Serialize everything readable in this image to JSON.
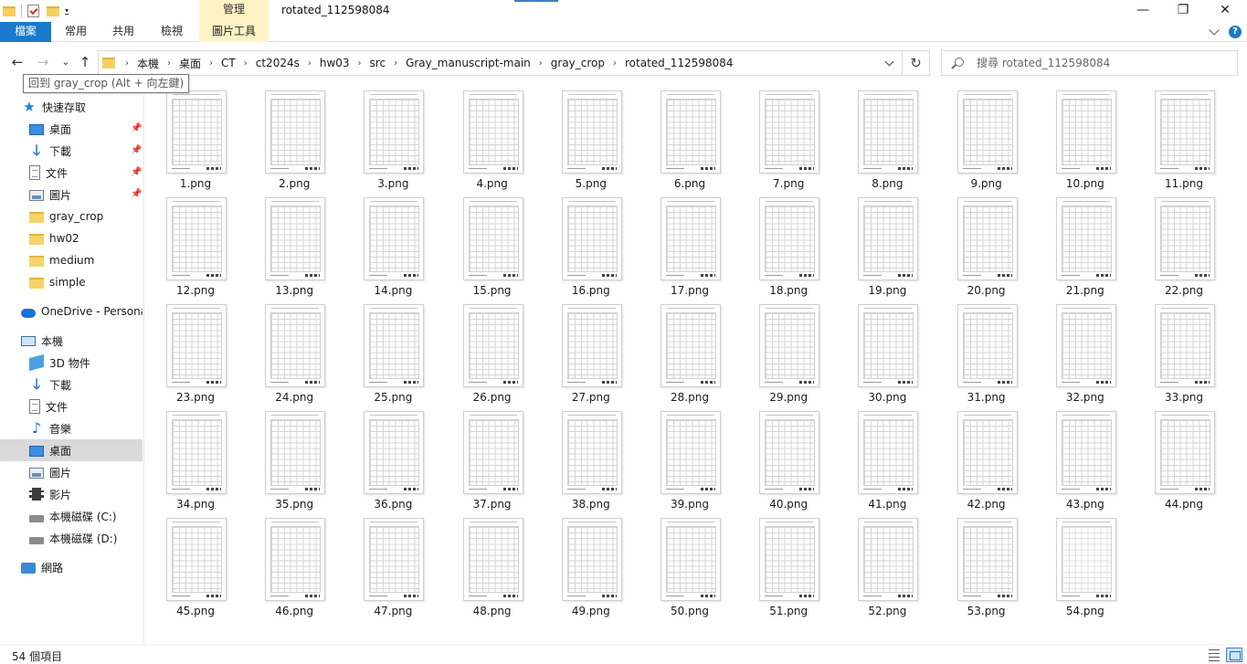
{
  "window": {
    "title": "rotated_112598084",
    "controls": {
      "minimize": "—",
      "maximize": "❐",
      "close": "✕"
    }
  },
  "ribbon": {
    "context_group": "管理",
    "tabs": [
      {
        "label": "檔案"
      },
      {
        "label": "常用"
      },
      {
        "label": "共用"
      },
      {
        "label": "檢視"
      },
      {
        "label": "圖片工具"
      }
    ],
    "accent_color": "#1979ca",
    "context_color": "#fdf3c4"
  },
  "nav_buttons": {
    "back": "←",
    "forward": "→",
    "recent": "⌄",
    "up": "↑",
    "refresh": "↻"
  },
  "address": {
    "crumbs": [
      "本機",
      "桌面",
      "CT",
      "ct2024s",
      "hw03",
      "src",
      "Gray_manuscript-main",
      "gray_crop",
      "rotated_112598084"
    ],
    "separator": "›"
  },
  "search": {
    "placeholder": "搜尋 rotated_112598084"
  },
  "tooltip": "回到 gray_crop (Alt + 向左鍵)",
  "sidebar": {
    "quick_access": "快速存取",
    "pinned": [
      {
        "label": "桌面",
        "icon": "desktop-icon"
      },
      {
        "label": "下載",
        "icon": "download-icon"
      },
      {
        "label": "文件",
        "icon": "document-icon"
      },
      {
        "label": "圖片",
        "icon": "pictures-icon"
      }
    ],
    "folders": [
      "gray_crop",
      "hw02",
      "medium",
      "simple"
    ],
    "onedrive": "OneDrive - Personal",
    "this_pc": "本機",
    "pc_items": [
      {
        "label": "3D 物件",
        "icon": "3d-objects-icon"
      },
      {
        "label": "下載",
        "icon": "download-icon"
      },
      {
        "label": "文件",
        "icon": "document-icon"
      },
      {
        "label": "音樂",
        "icon": "music-icon"
      },
      {
        "label": "桌面",
        "icon": "desktop-icon"
      },
      {
        "label": "圖片",
        "icon": "pictures-icon"
      },
      {
        "label": "影片",
        "icon": "videos-icon"
      },
      {
        "label": "本機磁碟 (C:)",
        "icon": "drive-icon"
      },
      {
        "label": "本機磁碟 (D:)",
        "icon": "drive-icon"
      }
    ],
    "network": "網路",
    "selected_item": "桌面"
  },
  "files": [
    "1.png",
    "2.png",
    "3.png",
    "4.png",
    "5.png",
    "6.png",
    "7.png",
    "8.png",
    "9.png",
    "10.png",
    "11.png",
    "12.png",
    "13.png",
    "14.png",
    "15.png",
    "16.png",
    "17.png",
    "18.png",
    "19.png",
    "20.png",
    "21.png",
    "22.png",
    "23.png",
    "24.png",
    "25.png",
    "26.png",
    "27.png",
    "28.png",
    "29.png",
    "30.png",
    "31.png",
    "32.png",
    "33.png",
    "34.png",
    "35.png",
    "36.png",
    "37.png",
    "38.png",
    "39.png",
    "40.png",
    "41.png",
    "42.png",
    "43.png",
    "44.png",
    "45.png",
    "46.png",
    "47.png",
    "48.png",
    "49.png",
    "50.png",
    "51.png",
    "52.png",
    "53.png",
    "54.png"
  ],
  "status": {
    "item_count": "54 個項目"
  }
}
